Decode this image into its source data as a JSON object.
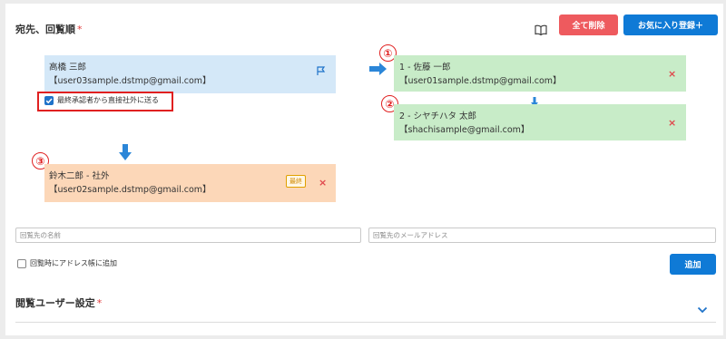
{
  "recipients": {
    "title": "宛先、回覧順",
    "required_mark": "*",
    "clear_all_label": "全て削除",
    "favorite_label": "お気に入り登録＋"
  },
  "sender_card": {
    "name": "高橋 三郎",
    "email": "【user03sample.dstmp@gmail.com】"
  },
  "direct_send_checkbox": {
    "label": "最終承認者から直接社外に送る",
    "checked": true
  },
  "approvers": [
    {
      "number": "①",
      "name": "1 - 佐藤 一郎",
      "email": "【user01sample.dstmp@gmail.com】",
      "remove": "×"
    },
    {
      "number": "②",
      "name": "2 - シヤチハタ 太郎",
      "email": "【shachisample@gmail.com】",
      "remove": "×"
    }
  ],
  "external_card": {
    "number": "③",
    "name": "鈴木二郎 - 社外",
    "email": "【user02sample.dstmp@gmail.com】",
    "badge": "最終",
    "remove": "×"
  },
  "add_form": {
    "name_placeholder": "回覧先の名前",
    "email_placeholder": "回覧先のメールアドレス",
    "address_book_label": "回覧時にアドレス帳に追加",
    "add_label": "追加"
  },
  "viewers": {
    "title": "閲覧ユーザー設定",
    "required_mark": "*"
  },
  "colors": {
    "accent_blue": "#0f7ad6",
    "danger_red": "#ee5a5e",
    "card_blue": "#d4e8f8",
    "card_green": "#c8ecc8",
    "card_orange": "#fcd7b8"
  }
}
